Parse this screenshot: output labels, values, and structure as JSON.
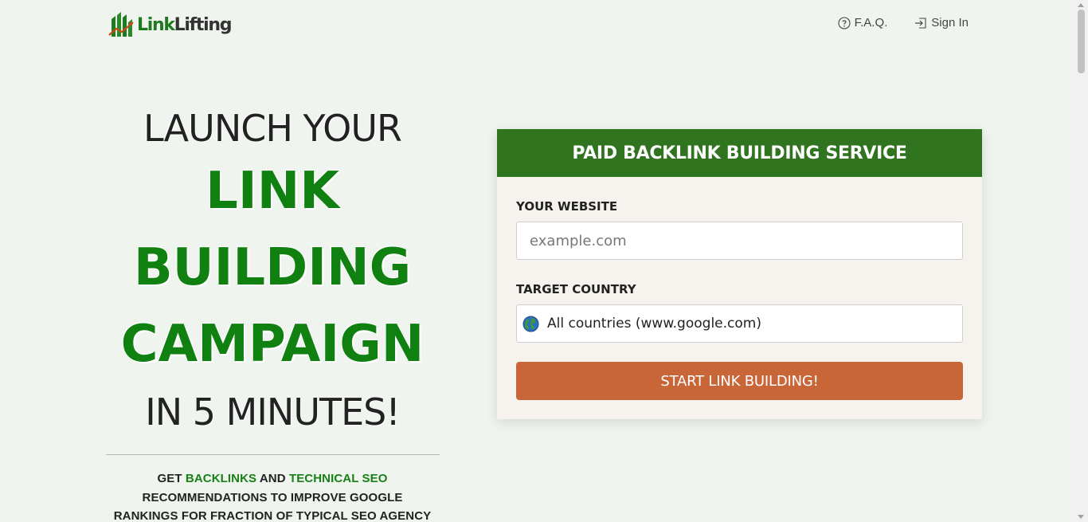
{
  "header": {
    "logo": {
      "part1": "Link",
      "part2": "Lifting"
    },
    "nav": [
      {
        "label": "F.A.Q.",
        "icon": "question-circle-icon"
      },
      {
        "label": "Sign In",
        "icon": "sign-in-icon"
      }
    ]
  },
  "hero": {
    "line1": "LAUNCH YOUR",
    "line2": "LINK",
    "line3": "BUILDING",
    "line4": "CAMPAIGN",
    "line5": "IN 5 MINUTES!",
    "sub": {
      "prefix": "GET ",
      "hl1": "BACKLINKS",
      "mid": " AND ",
      "hl2": "TECHNICAL SEO",
      "line2": "RECOMMENDATIONS TO IMPROVE GOOGLE",
      "line3": "RANKINGS FOR FRACTION OF TYPICAL SEO AGENCY"
    }
  },
  "form": {
    "title": "PAID BACKLINK BUILDING SERVICE",
    "website_label": "YOUR WEBSITE",
    "website_placeholder": "example.com",
    "website_value": "",
    "country_label": "TARGET COUNTRY",
    "country_value": "All countries (www.google.com)",
    "country_icon": "globe-icon",
    "submit_label": "START LINK BUILDING!"
  },
  "colors": {
    "brand_green": "#317420",
    "hero_green": "#108010",
    "cta_orange": "#c96638",
    "page_bg": "#f0f4ef"
  }
}
